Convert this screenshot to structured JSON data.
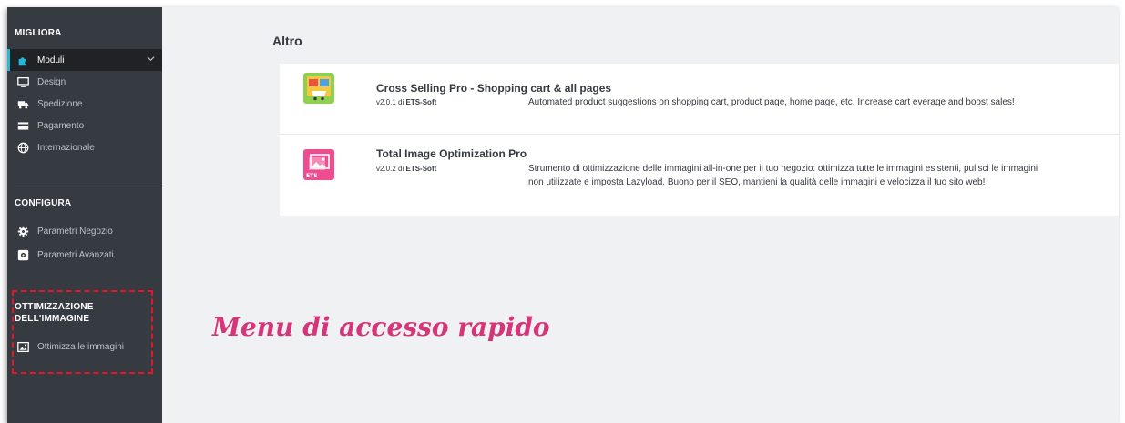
{
  "sidebar": {
    "section_migliora": "MIGLIORA",
    "items_migliora": [
      {
        "label": "Moduli",
        "icon": "puzzle-icon",
        "active": true
      },
      {
        "label": "Design",
        "icon": "monitor-icon"
      },
      {
        "label": "Spedizione",
        "icon": "truck-icon"
      },
      {
        "label": "Pagamento",
        "icon": "credit-card-icon"
      },
      {
        "label": "Internazionale",
        "icon": "globe-icon"
      }
    ],
    "section_configura": "CONFIGURA",
    "items_configura": [
      {
        "label": "Parametri Negozio",
        "icon": "gear-icon"
      },
      {
        "label": "Parametri Avanzati",
        "icon": "advanced-settings-icon"
      }
    ],
    "section_ottimizzazione_line1": "OTTIMIZZAZIONE",
    "section_ottimizzazione_line2": "DELL'IMMAGINE",
    "items_ottimizzazione": [
      {
        "label": "Ottimizza le immagini",
        "icon": "image-icon"
      }
    ],
    "accent_color": "#25b9d7",
    "highlight_color": "#e8142a"
  },
  "main": {
    "section_title": "Altro",
    "modules": [
      {
        "name": "Cross Selling Pro - Shopping cart & all pages",
        "version": "v2.0.1",
        "by": "di",
        "author": "ETS-Soft",
        "description": "Automated product suggestions on shopping cart, product page, home page, etc. Increase cart everage and boost sales!",
        "icon": "cross-selling-icon"
      },
      {
        "name": "Total Image Optimization Pro",
        "version": "v2.0.2",
        "by": "di",
        "author": "ETS-Soft",
        "description": "Strumento di ottimizzazione delle immagini all-in-one per il tuo negozio: ottimizza tutte le immagini esistenti, pulisci le immagini non utilizzate e imposta Lazyload. Buono per il SEO, mantieni la qualità delle immagini e velocizza il tuo sito web!",
        "icon": "image-optimization-icon",
        "icon_badge": "ETS"
      }
    ]
  },
  "annotation": {
    "label": "Menu di accesso rapido",
    "color": "#d6357a"
  }
}
